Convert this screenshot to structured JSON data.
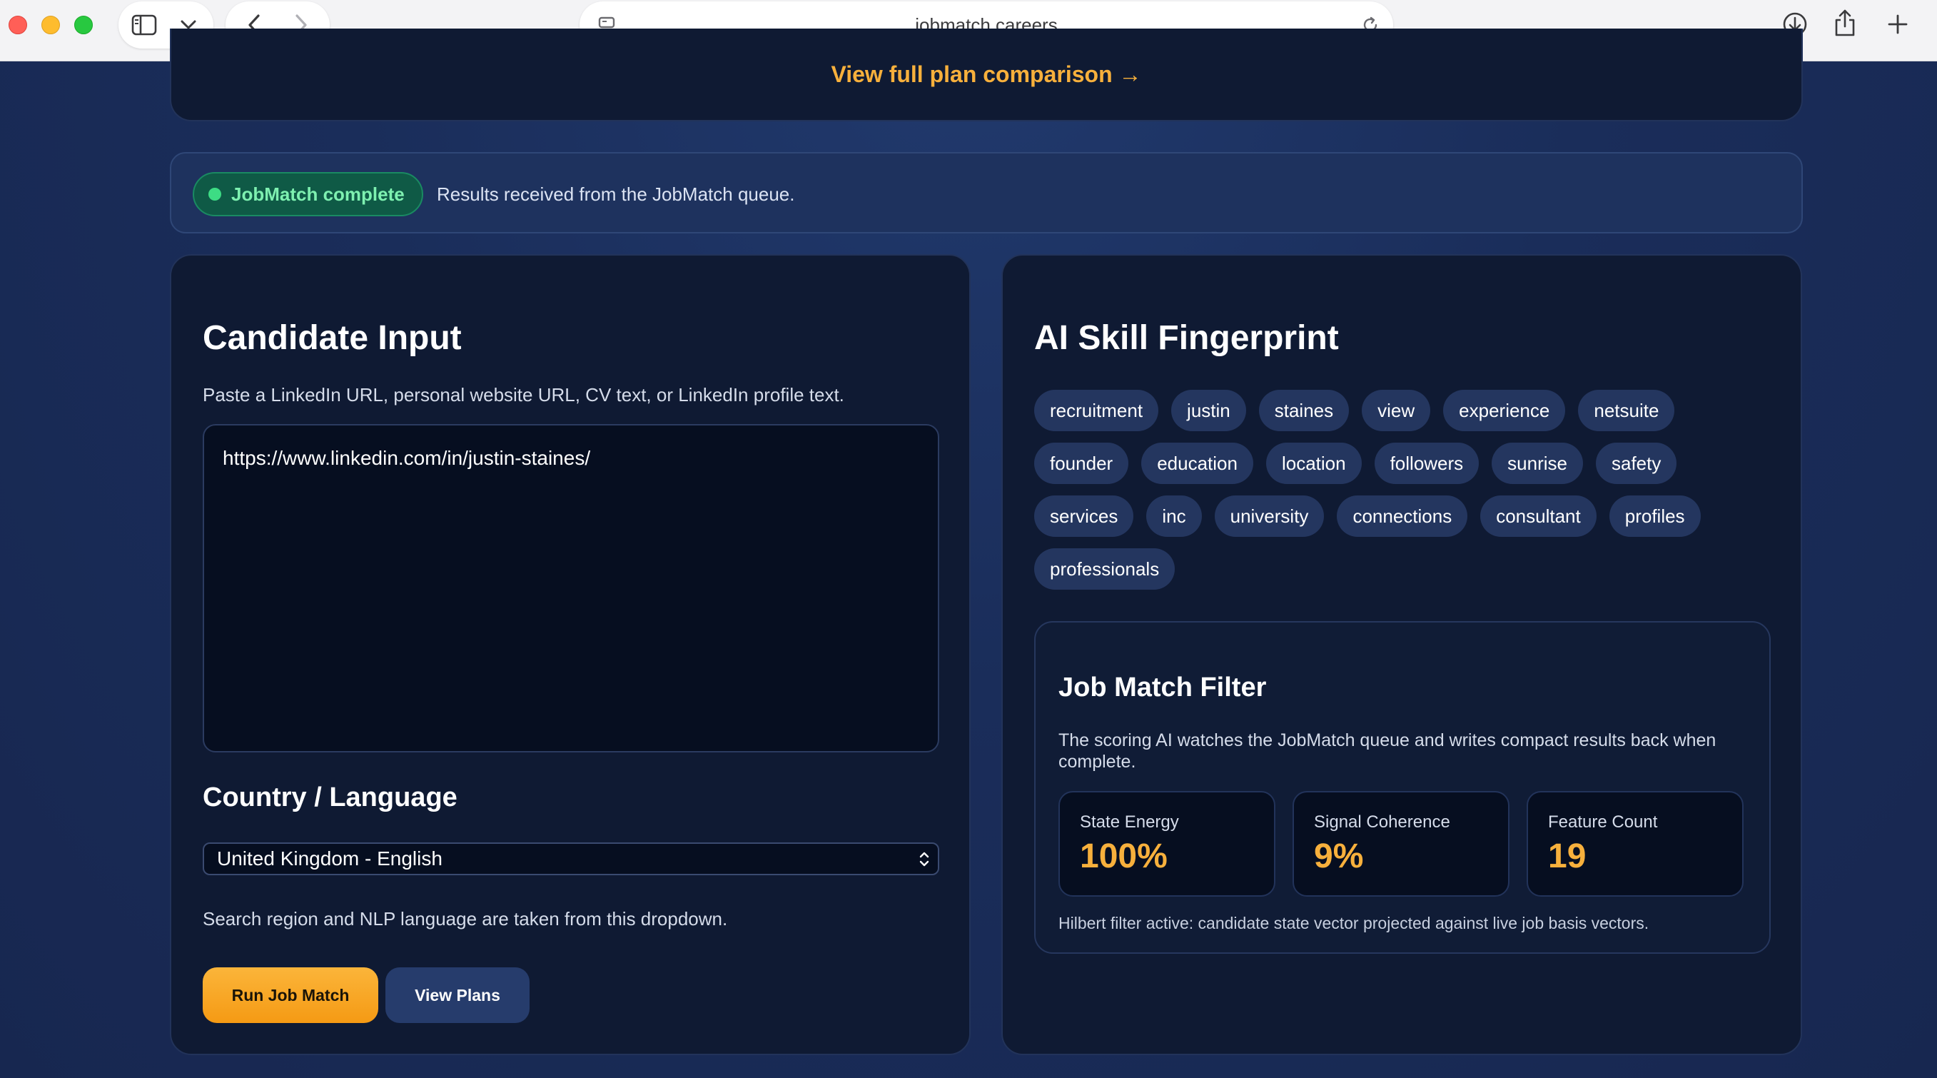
{
  "browser": {
    "url": "jobmatch.careers"
  },
  "plans": {
    "link_label": "View full plan comparison →"
  },
  "status": {
    "badge": "JobMatch complete",
    "message": "Results received from the JobMatch queue."
  },
  "candidate": {
    "title": "Candidate Input",
    "hint": "Paste a LinkedIn URL, personal website URL, CV text, or LinkedIn profile text.",
    "input_value": "https://www.linkedin.com/in/justin-staines/",
    "country_title": "Country / Language",
    "country_selected": "United Kingdom - English",
    "country_hint": "Search region and NLP language are taken from this dropdown.",
    "run_button": "Run Job Match",
    "plans_button": "View Plans"
  },
  "fingerprint": {
    "title": "AI Skill Fingerprint",
    "tags": [
      "recruitment",
      "justin",
      "staines",
      "view",
      "experience",
      "netsuite",
      "founder",
      "education",
      "location",
      "followers",
      "sunrise",
      "safety",
      "services",
      "inc",
      "university",
      "connections",
      "consultant",
      "profiles",
      "professionals"
    ]
  },
  "filter": {
    "title": "Job Match Filter",
    "description": "The scoring AI watches the JobMatch queue and writes compact results back when complete.",
    "metrics": [
      {
        "label": "State Energy",
        "value": "100%"
      },
      {
        "label": "Signal Coherence",
        "value": "9%"
      },
      {
        "label": "Feature Count",
        "value": "19"
      }
    ],
    "footnote": "Hilbert filter active: candidate state vector projected against live job basis vectors."
  },
  "colors": {
    "accent": "#f7b03c",
    "success": "#3ddc84",
    "card": "#0f1a33",
    "tag": "#24365f"
  }
}
